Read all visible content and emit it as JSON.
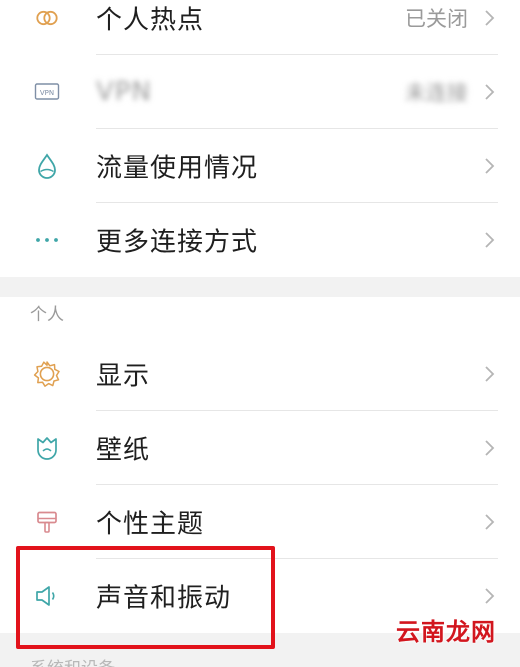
{
  "rows": [
    {
      "label": "个人热点",
      "value": "已关闭"
    },
    {
      "label": "VPN",
      "value": "未连接"
    },
    {
      "label": "流量使用情况"
    },
    {
      "label": "更多连接方式"
    },
    {
      "label": "显示"
    },
    {
      "label": "壁纸"
    },
    {
      "label": "个性主题"
    },
    {
      "label": "声音和振动"
    }
  ],
  "section": {
    "personal": "个人",
    "next": "系统和设备"
  },
  "icons": {
    "hotspot": "hotspot-icon",
    "vpn": "vpn-icon",
    "vpn_text": "VPN",
    "data_usage": "drop-icon",
    "more": "more-icon",
    "display": "brightness-icon",
    "wallpaper": "wallpaper-icon",
    "theme": "theme-icon",
    "sound": "speaker-icon"
  },
  "watermark": "云南龙网",
  "colors": {
    "icon_orange": "#e0a050",
    "icon_teal": "#3fa6a8",
    "icon_rose": "#d98a8f",
    "highlight": "#e2121b"
  }
}
